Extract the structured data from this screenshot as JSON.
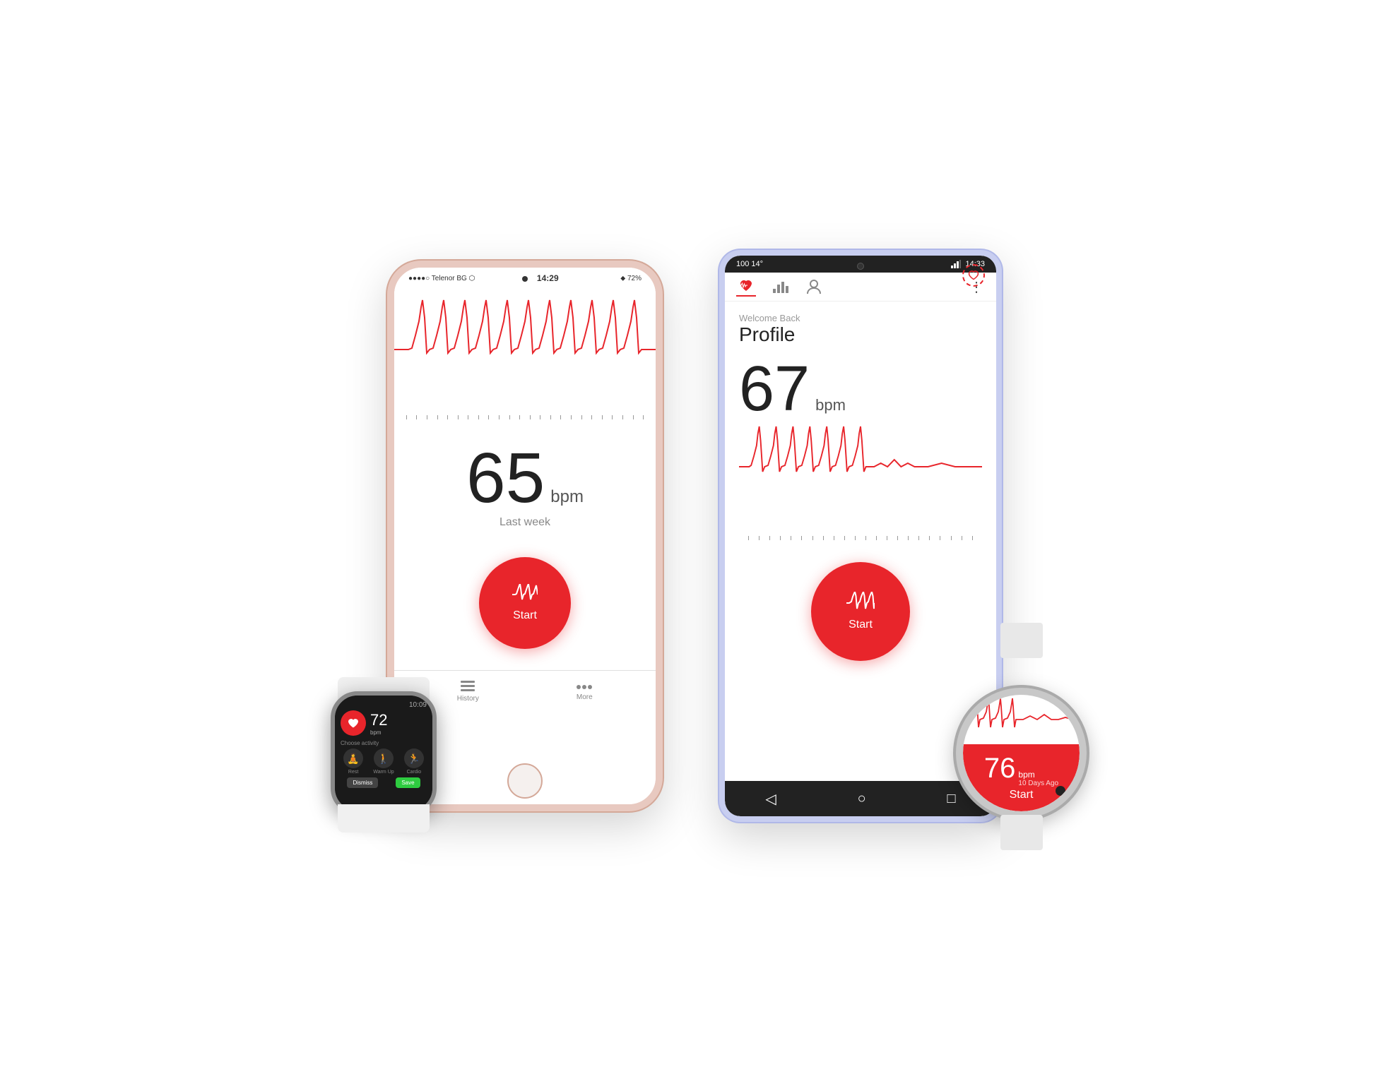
{
  "iphone": {
    "status": {
      "carrier": "●●●●○ Telenor BG ⬡",
      "time": "14:29",
      "battery": "⬥ 72%"
    },
    "bpm_number": "65",
    "bpm_label": "bpm",
    "bpm_subtitle": "Last week",
    "start_label": "Start",
    "tabs": [
      {
        "label": "History",
        "icon": "list-icon"
      },
      {
        "label": "More",
        "icon": "more-icon"
      }
    ]
  },
  "apple_watch": {
    "time": "10:09",
    "bpm_number": "72",
    "bpm_unit": "bpm",
    "choose_label": "Choose activity",
    "activities": [
      {
        "label": "Rest",
        "icon": "🧘"
      },
      {
        "label": "Warm Up",
        "icon": "🚶"
      },
      {
        "label": "Cardio",
        "icon": "🏃"
      }
    ],
    "dismiss_label": "Dismiss",
    "save_label": "Save"
  },
  "android": {
    "status": {
      "left": "100  14°",
      "time": "14:33"
    },
    "welcome": "Welcome Back",
    "profile": "Profile",
    "bpm_number": "67",
    "bpm_label": "bpm",
    "start_label": "Start"
  },
  "samsung_watch": {
    "bpm_number": "76",
    "bpm_label": "bpm",
    "bpm_sub": "10 Days Ago",
    "start_label": "Start"
  }
}
